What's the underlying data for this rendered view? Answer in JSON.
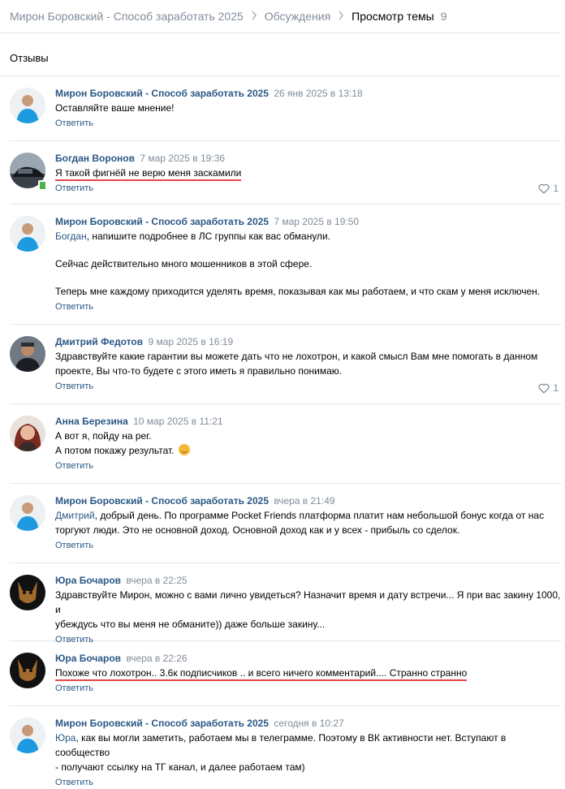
{
  "breadcrumb": {
    "items": [
      "Мирон Боровский - Способ заработать 2025",
      "Обсуждения",
      "Просмотр темы"
    ],
    "count": "9"
  },
  "section_title": "Отзывы",
  "reply_label": "Ответить",
  "colors": {
    "link": "#2a5885",
    "meta": "#818c99",
    "underline": "#e64646",
    "online": "#4bb34b"
  },
  "comments": [
    {
      "author": "Мирон Боровский - Способ заработать 2025",
      "date": "26 янв 2025 в 13:18",
      "text": "Оставляйте ваше мнение!"
    },
    {
      "author": "Богдан Воронов",
      "date": "7 мар 2025 в 19:36",
      "text": "Я такой фигнёй не верю меня заскамили",
      "likes": "1"
    },
    {
      "author": "Мирон Боровский - Способ заработать 2025",
      "date": "7 мар 2025 в 19:50",
      "mention": "Богдан",
      "text_rest": ", напишите подробнее в ЛС группы как вас обманули.",
      "p2": "Сейчас действительно много мошенников в этой сфере.",
      "p3": "Теперь мне каждому приходится уделять время, показывая как мы работаем, и что скам у меня исключен."
    },
    {
      "author": "Дмитрий Федотов",
      "date": "9 мар 2025 в 16:19",
      "line1": "Здравствуйте какие гарантии вы можете дать что не лохотрон, и какой смысл Вам мне помогать в данном",
      "line2": "проекте, Вы что-то будете с этого иметь я правильно понимаю.",
      "likes": "1"
    },
    {
      "author": "Анна Березина",
      "date": "10 мар 2025 в 11:21",
      "line1": "А вот я, пойду на рег.",
      "line2": "А потом покажу результат.",
      "emoji": "smiling-face-emoji"
    },
    {
      "author": "Мирон Боровский - Способ заработать 2025",
      "date": "вчера в 21:49",
      "mention": "Дмитрий",
      "line1_rest": ", добрый день. По программе Pocket Friends платформа платит нам небольшой бонус когда от нас",
      "line2": "торгуют люди. Это не основной доход. Основной доход как и у всех - прибыль со сделок."
    },
    {
      "author": "Юра Бочаров",
      "date": "вчера в 22:25",
      "line1": "Здравствуйте Мирон, можно с вами лично увидеться? Назначит время и дату встречи... Я при вас закину 1000, и",
      "line2": "убеждусь что вы меня не обманите)) даже больше закину..."
    },
    {
      "author": "Юра Бочаров",
      "date": "вчера в 22:26",
      "text": "Похоже что лохотрон.. 3.6к подписчиков .. и всего ничего комментарий.... Странно странно"
    },
    {
      "author": "Мирон Боровский - Способ заработать 2025",
      "date": "сегодня в 10:27",
      "mention": "Юра",
      "line1_rest": ", как вы могли заметить, работаем мы в телеграмме. Поэтому в ВК активности нет. Вступают в сообщество",
      "line2": "- получают ссылку на ТГ канал, и далее работаем там)"
    }
  ]
}
